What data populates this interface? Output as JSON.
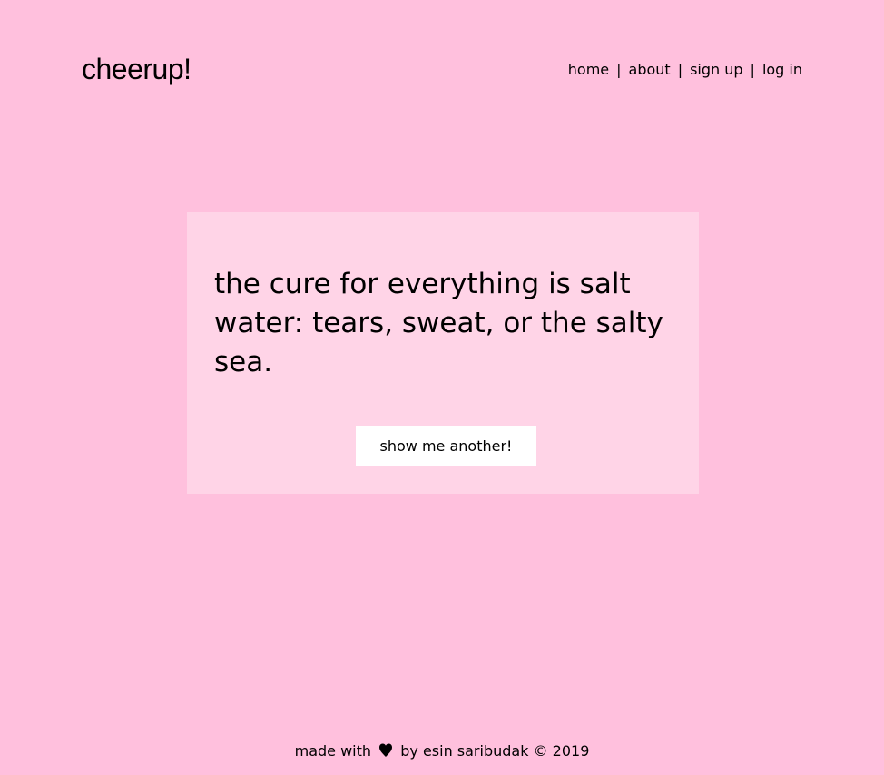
{
  "header": {
    "logo": "cheerup!",
    "nav": [
      {
        "label": "home"
      },
      {
        "label": "about"
      },
      {
        "label": "sign up"
      },
      {
        "label": "log in"
      }
    ],
    "separator": "|"
  },
  "card": {
    "quote": "the cure for everything is salt water: tears, sweat, or the salty sea.",
    "button_label": "show me another!"
  },
  "footer": {
    "made_with": "made with",
    "by": "by",
    "author": "esin saribudak",
    "copyright": "© 2019",
    "icon": "heart-icon"
  },
  "colors": {
    "background": "#ffc0dd",
    "card": "#ffd4e7",
    "button": "#ffffff",
    "text": "#000000"
  }
}
